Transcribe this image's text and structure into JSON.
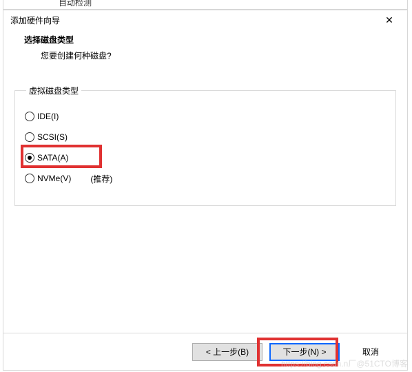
{
  "partial_top_text": "自动检测",
  "dialog": {
    "title": "添加硬件向导",
    "header": {
      "heading": "选择磁盘类型",
      "sub": "您要创建何种磁盘?"
    },
    "group_legend": "虚拟磁盘类型",
    "options": {
      "ide": "IDE(I)",
      "scsi": "SCSI(S)",
      "sata": "SATA(A)",
      "nvme": "NVMe(V)",
      "nvme_note": "(推荐)"
    },
    "footer": {
      "back": "< 上一步(B)",
      "next": "下一步(N) >",
      "cancel": "取消"
    }
  },
  "watermark": "https://blog.csdn.n厂@51CTO博客"
}
